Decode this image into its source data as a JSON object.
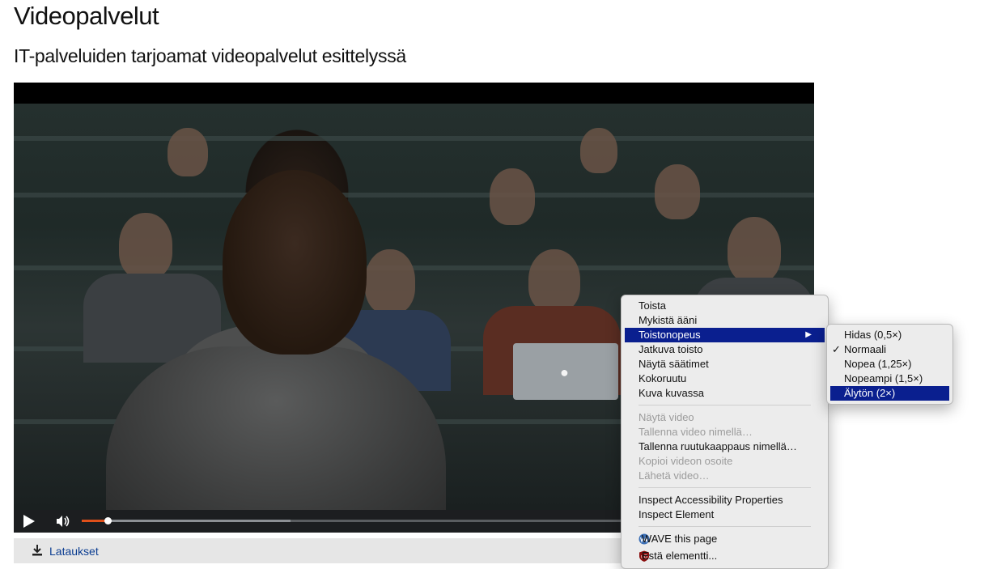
{
  "page": {
    "title": "Videopalvelut",
    "subtitle": "IT-palveluiden tarjoamat videopalvelut esittelyssä"
  },
  "video": {
    "progress_fraction": 0.035,
    "buffered_fraction": 0.3,
    "controls": {
      "play_icon": "play-icon",
      "volume_icon": "volume-icon"
    }
  },
  "downloads": {
    "label": "Lataukset",
    "icon": "download-icon"
  },
  "context_menu": {
    "items": [
      {
        "label": "Toista",
        "state": "normal"
      },
      {
        "label": "Mykistä ääni",
        "state": "normal"
      },
      {
        "label": "Toistonopeus",
        "state": "active",
        "submenu": true
      },
      {
        "label": "Jatkuva toisto",
        "state": "normal"
      },
      {
        "label": "Näytä säätimet",
        "state": "normal"
      },
      {
        "label": "Kokoruutu",
        "state": "normal"
      },
      {
        "label": "Kuva kuvassa",
        "state": "normal"
      },
      {
        "label": "Näytä video",
        "state": "disabled"
      },
      {
        "label": "Tallenna video nimellä…",
        "state": "disabled"
      },
      {
        "label": "Tallenna ruutukaappaus nimellä…",
        "state": "normal"
      },
      {
        "label": "Kopioi videon osoite",
        "state": "disabled"
      },
      {
        "label": "Lähetä video…",
        "state": "disabled"
      },
      {
        "label": "Inspect Accessibility Properties",
        "state": "normal"
      },
      {
        "label": "Inspect Element",
        "state": "normal"
      },
      {
        "label": "WAVE this page",
        "state": "normal",
        "icon": "wave-icon"
      },
      {
        "label": "Estä elementti...",
        "state": "normal",
        "icon": "ublock-icon"
      }
    ]
  },
  "speed_submenu": {
    "items": [
      {
        "label": "Hidas (0,5×)",
        "checked": false,
        "state": "normal"
      },
      {
        "label": "Normaali",
        "checked": true,
        "state": "normal"
      },
      {
        "label": "Nopea (1,25×)",
        "checked": false,
        "state": "normal"
      },
      {
        "label": "Nopeampi (1,5×)",
        "checked": false,
        "state": "normal"
      },
      {
        "label": "Älytön (2×)",
        "checked": false,
        "state": "active"
      }
    ],
    "check_glyph": "✓"
  },
  "colors": {
    "menu_highlight": "#0a1f8f",
    "progress": "#e0501a",
    "link": "#0b3d91"
  }
}
